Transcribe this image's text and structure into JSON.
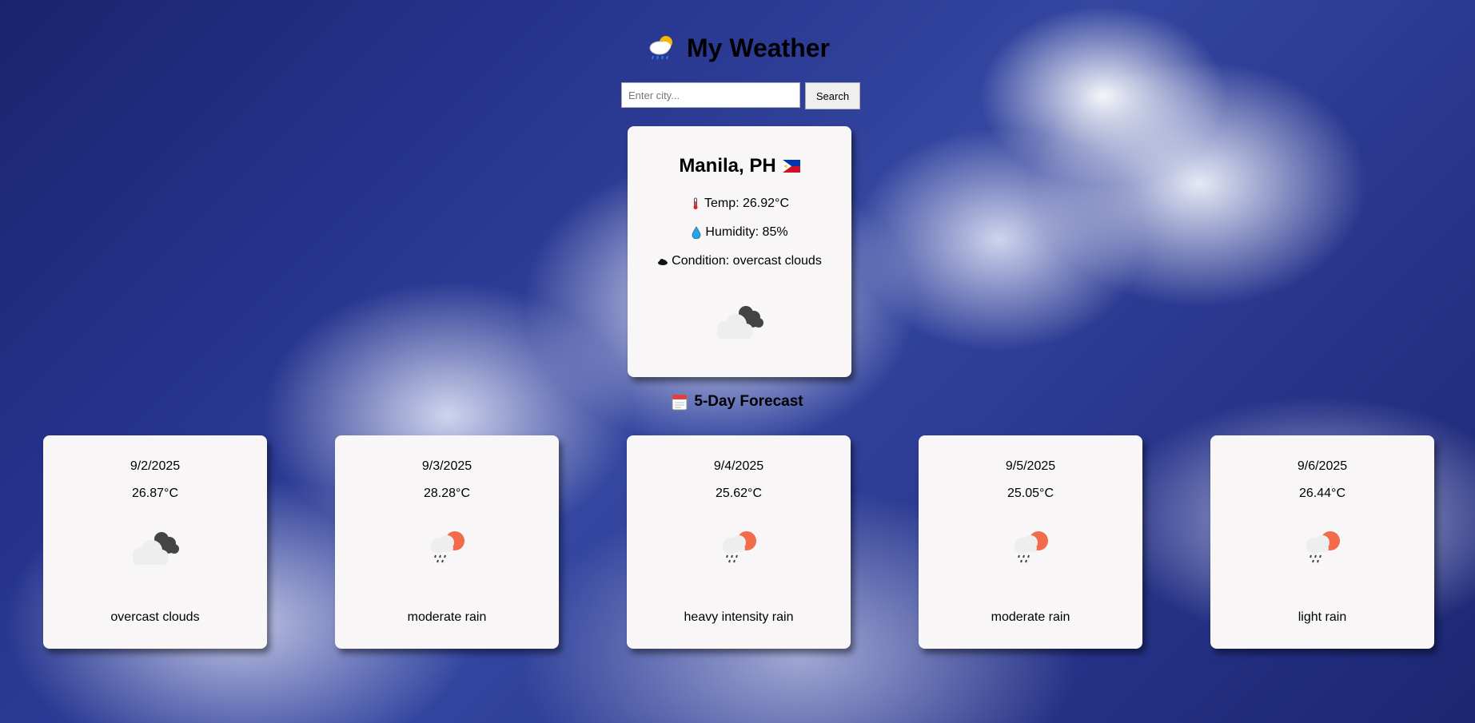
{
  "app": {
    "title": "My Weather",
    "logo_icon": "cloud-sun-rain-icon"
  },
  "search": {
    "placeholder": "Enter city...",
    "value": "",
    "button_label": "Search"
  },
  "current": {
    "city": "Manila, PH",
    "flag_icon": "philippines-flag-icon",
    "temp_text": "Temp: 26.92°C",
    "humidity_text": "Humidity: 85%",
    "condition_text": "Condition: overcast clouds",
    "icon": "overcast-clouds-icon"
  },
  "forecast": {
    "title": "5-Day Forecast",
    "days": [
      {
        "date": "9/2/2025",
        "temp": "26.87°C",
        "description": "overcast clouds",
        "icon": "overcast-clouds-icon"
      },
      {
        "date": "9/3/2025",
        "temp": "28.28°C",
        "description": "moderate rain",
        "icon": "sun-rain-icon"
      },
      {
        "date": "9/4/2025",
        "temp": "25.62°C",
        "description": "heavy intensity rain",
        "icon": "sun-rain-icon"
      },
      {
        "date": "9/5/2025",
        "temp": "25.05°C",
        "description": "moderate rain",
        "icon": "sun-rain-icon"
      },
      {
        "date": "9/6/2025",
        "temp": "26.44°C",
        "description": "light rain",
        "icon": "sun-rain-icon"
      }
    ]
  },
  "colors": {
    "card_bg": "#f8f6f7",
    "sky_dark": "#1a246e",
    "sun": "#f26b4a",
    "dark_cloud": "#444444",
    "light_cloud": "#eeeeee"
  }
}
